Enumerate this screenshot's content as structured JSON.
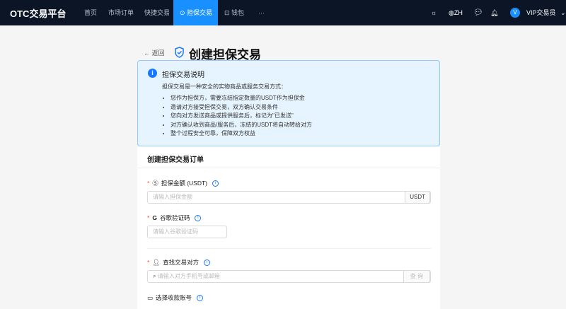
{
  "nav": {
    "logo": "OTC交易平台",
    "items": [
      "首页",
      "市场订单",
      "快捷交易",
      "担保交易",
      "钱包",
      "···"
    ],
    "lang": "ZH",
    "avatar": "V",
    "user": "VIP交易员"
  },
  "page": {
    "back": "返回",
    "title": "创建担保交易"
  },
  "info": {
    "title": "担保交易说明",
    "desc": "担保交易是一种安全的实物商品或服务交易方式：",
    "bullets": [
      "您作为担保方，需要冻结指定数量的USDT作为担保金",
      "邀请对方接受担保交易，双方确认交易条件",
      "您向对方发送商品或提供服务后，标记为\"已发送\"",
      "对方确认收到商品/服务后，冻结的USDT将自动转给对方",
      "整个过程安全可靠，保障双方权益"
    ]
  },
  "form": {
    "title": "创建担保交易订单",
    "amount_label": "担保金额 (USDT)",
    "amount_placeholder": "请输入担保金额",
    "amount_unit": "USDT",
    "google_label": "谷歌验证码",
    "google_placeholder": "请输入谷歌验证码",
    "party_label": "查找交易对方",
    "party_placeholder": "请输入对方手机号或邮箱",
    "query": "查 询",
    "account_label": "选择收款账号"
  }
}
